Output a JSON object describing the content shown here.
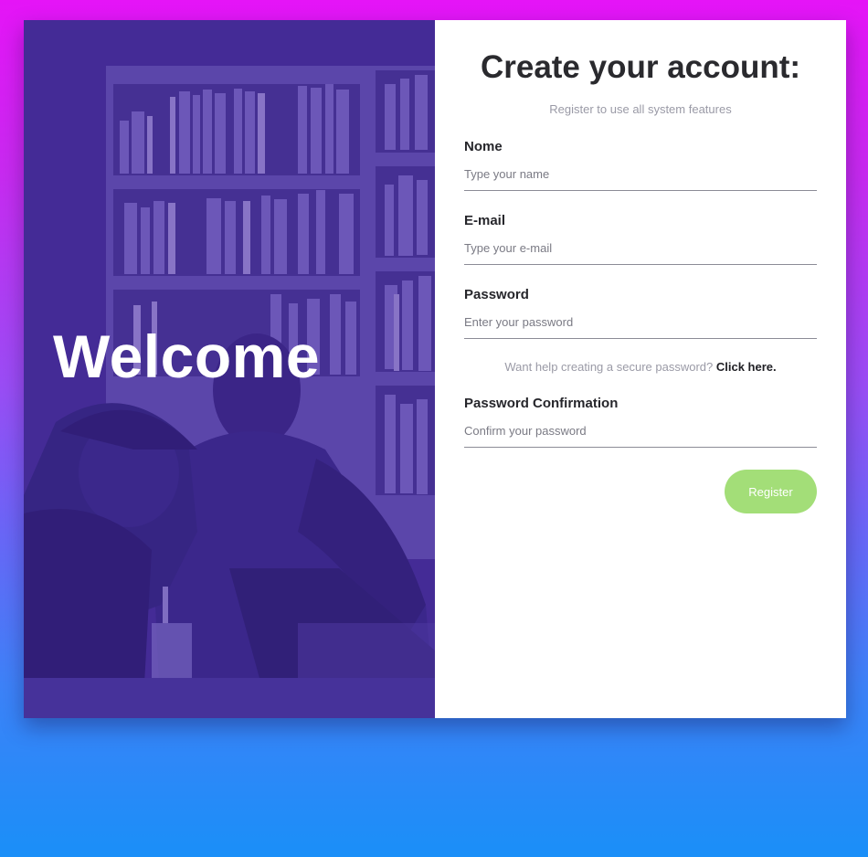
{
  "hero": {
    "heading": "Welcome"
  },
  "form": {
    "title": "Create your account:",
    "subtitle": "Register to use all system features",
    "fields": [
      {
        "label": "Nome",
        "placeholder": "Type your name",
        "value": ""
      },
      {
        "label": "E-mail",
        "placeholder": "Type your e-mail",
        "value": ""
      },
      {
        "label": "Password",
        "placeholder": "Enter your password",
        "value": ""
      },
      {
        "label": "Password Confirmation",
        "placeholder": "Confirm your password",
        "value": ""
      }
    ],
    "help_text": "Want help creating a secure password?",
    "help_link": "Click here.",
    "submit_label": "Register"
  },
  "colors": {
    "accent_button": "#a3de78",
    "hero_tint": "#3a2789",
    "text_dark": "#26262b",
    "text_muted": "#9a9aa6"
  }
}
